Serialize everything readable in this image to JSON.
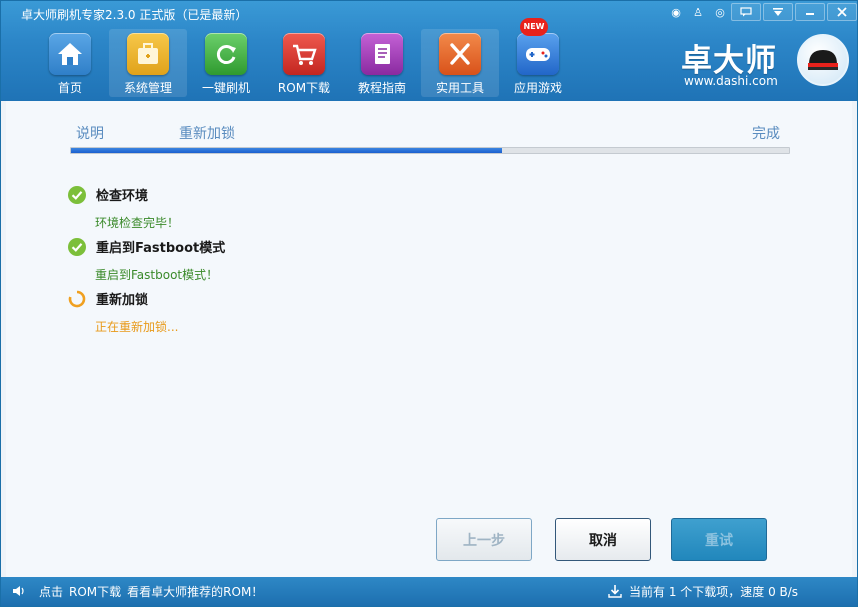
{
  "window": {
    "title": "卓大师刷机专家2.3.0 正式版（已是最新）"
  },
  "nav": {
    "items": [
      {
        "label": "首页",
        "icon": "home-icon",
        "color": "#2f7fc8"
      },
      {
        "label": "系统管理",
        "icon": "toolbox-icon",
        "color": "#e0a21a"
      },
      {
        "label": "一键刷机",
        "icon": "refresh-icon",
        "color": "#3aa83a"
      },
      {
        "label": "ROM下载",
        "icon": "cart-icon",
        "color": "#d9312a"
      },
      {
        "label": "教程指南",
        "icon": "book-icon",
        "color": "#9a3aae"
      },
      {
        "label": "实用工具",
        "icon": "tools-icon",
        "color": "#e05a1a"
      },
      {
        "label": "应用游戏",
        "icon": "gamepad-icon",
        "color": "#2a7ad8"
      }
    ],
    "badge": "NEW"
  },
  "brand": {
    "name": "卓大师",
    "url": "www.dashi.com"
  },
  "steps": {
    "s1": "说明",
    "s2": "重新加锁",
    "s3": "完成",
    "progress": 0.6
  },
  "tasks": [
    {
      "title": "检查环境",
      "status": "环境检查完毕！",
      "state": "done"
    },
    {
      "title": "重启到Fastboot模式",
      "status": "重启到Fastboot模式！",
      "state": "done"
    },
    {
      "title": "重新加锁",
      "status": "正在重新加锁...",
      "state": "running"
    }
  ],
  "buttons": {
    "prev": "上一步",
    "cancel": "取消",
    "retry": "重试"
  },
  "statusbar": {
    "click": "点击",
    "link": "ROM下载",
    "tip": "看看卓大师推荐的ROM！",
    "download": "当前有 1 个下载项，速度 0 B/s"
  },
  "colors": {
    "accent": "#1f73b6",
    "done": "#3a8a2a",
    "running": "#e89a1a"
  }
}
